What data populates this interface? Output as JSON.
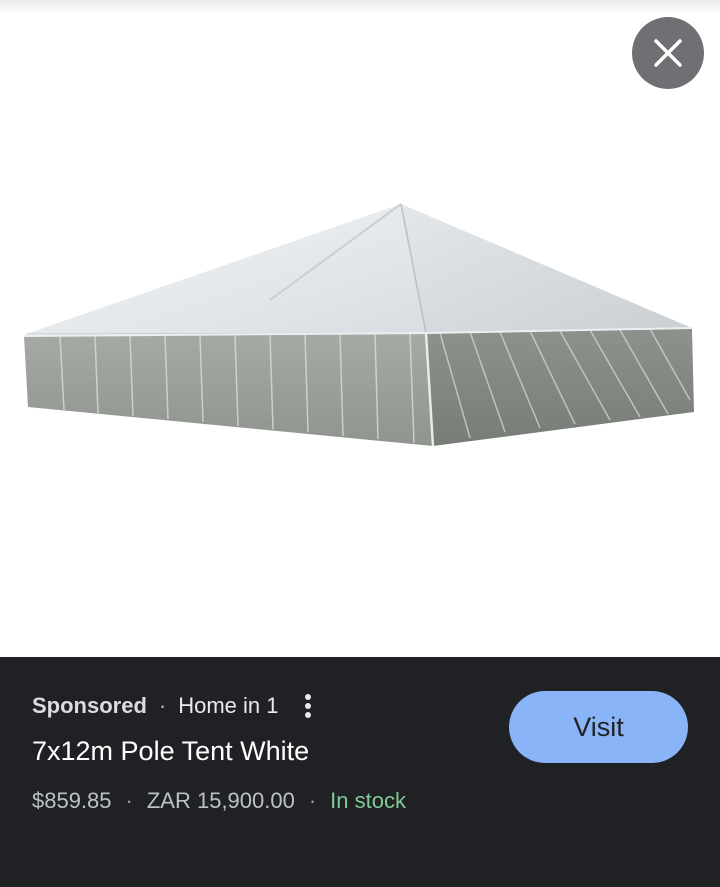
{
  "image": {
    "subject": "tent-product-photo"
  },
  "controls": {
    "close_icon": "close-icon",
    "more_icon": "more-vertical-icon"
  },
  "listing": {
    "sponsored_label": "Sponsored",
    "separator": "·",
    "merchant": "Home in 1",
    "title": "7x12m Pole Tent White",
    "price": "$859.85",
    "alt_price": "ZAR 15,900.00",
    "stock_status": "In stock",
    "visit_label": "Visit"
  },
  "colors": {
    "panel_bg": "#202124",
    "visit_button": "#8ab4f8",
    "stock_green": "#81c995",
    "close_button_bg": "#6f7073"
  }
}
